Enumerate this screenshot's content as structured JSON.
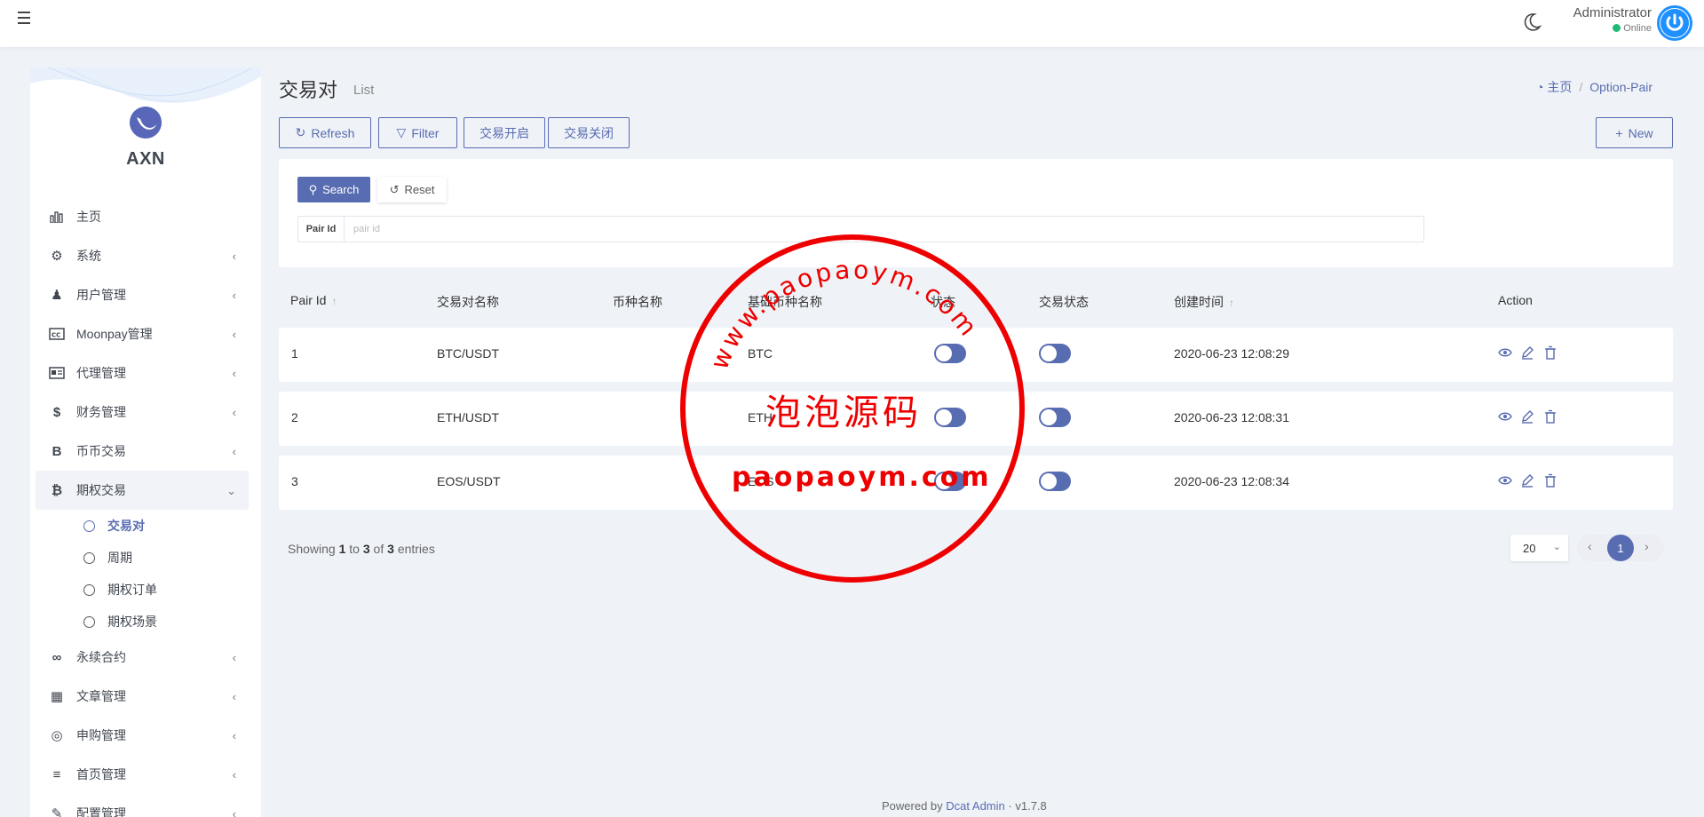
{
  "header": {
    "user_name": "Administrator",
    "user_status": "Online"
  },
  "sidebar": {
    "logo": "AXN",
    "items": [
      {
        "label": "主页",
        "icon": "bar-chart-icon",
        "glyph": "▥"
      },
      {
        "label": "系统",
        "icon": "gear-icon",
        "glyph": "⚙"
      },
      {
        "label": "用户管理",
        "icon": "user-icon",
        "glyph": "♟"
      },
      {
        "label": "Moonpay管理",
        "icon": "cc-icon",
        "glyph": "▣"
      },
      {
        "label": "代理管理",
        "icon": "id-card-icon",
        "glyph": "▤"
      },
      {
        "label": "财务管理",
        "icon": "dollar-icon",
        "glyph": "$"
      },
      {
        "label": "币币交易",
        "icon": "bitcoin-b-icon",
        "glyph": "B"
      },
      {
        "label": "期权交易",
        "icon": "bitcoin-icon",
        "glyph": "₿"
      },
      {
        "label": "永续合约",
        "icon": "link-icon",
        "glyph": "∞"
      },
      {
        "label": "文章管理",
        "icon": "newspaper-icon",
        "glyph": "▦"
      },
      {
        "label": "申购管理",
        "icon": "life-ring-icon",
        "glyph": "◎"
      },
      {
        "label": "首页管理",
        "icon": "list-icon",
        "glyph": "≡"
      },
      {
        "label": "配置管理",
        "icon": "wrench-icon",
        "glyph": "✎"
      }
    ],
    "sub_items": [
      {
        "label": "交易对"
      },
      {
        "label": "周期"
      },
      {
        "label": "期权订单"
      },
      {
        "label": "期权场景"
      }
    ]
  },
  "page": {
    "title": "交易对",
    "subtitle": "List",
    "breadcrumb_home": "主页",
    "breadcrumb_current": "Option-Pair"
  },
  "toolbar": {
    "refresh": "Refresh",
    "filter": "Filter",
    "open_trade": "交易开启",
    "close_trade": "交易关闭",
    "new": "New"
  },
  "filter": {
    "search": "Search",
    "reset": "Reset",
    "pair_id_label": "Pair Id",
    "pair_id_placeholder": "pair id",
    "pair_id_value": ""
  },
  "table": {
    "columns": [
      "Pair Id",
      "交易对名称",
      "币种名称",
      "基础币种名称",
      "状态",
      "交易状态",
      "创建时间",
      "Action"
    ],
    "rows": [
      {
        "id": "1",
        "pair_name": "BTC/USDT",
        "coin_name": "",
        "base_coin": "BTC",
        "status_on": true,
        "trade_on": true,
        "created": "2020-06-23 12:08:29"
      },
      {
        "id": "2",
        "pair_name": "ETH/USDT",
        "coin_name": "",
        "base_coin": "ETH",
        "status_on": true,
        "trade_on": true,
        "created": "2020-06-23 12:08:31"
      },
      {
        "id": "3",
        "pair_name": "EOS/USDT",
        "coin_name": "",
        "base_coin": "EOS",
        "status_on": true,
        "trade_on": true,
        "created": "2020-06-23 12:08:34"
      }
    ]
  },
  "pagination": {
    "showing_prefix": "Showing",
    "from": "1",
    "to_word": "to",
    "to": "3",
    "of_word": "of",
    "total": "3",
    "entries_word": "entries",
    "per_page": "20",
    "current_page": "1"
  },
  "footer": {
    "powered_by": "Powered by",
    "brand": "Dcat Admin",
    "separator": "·",
    "version": "v1.7.8"
  },
  "watermark": {
    "url_text": "www.paopaoym.com",
    "center_text": "泡泡源码",
    "bottom_text": "paopaoym.com"
  },
  "colors": {
    "primary": "#586cb1",
    "background": "#eff3f8",
    "online": "#21b978",
    "stamp": "#ee0000"
  }
}
